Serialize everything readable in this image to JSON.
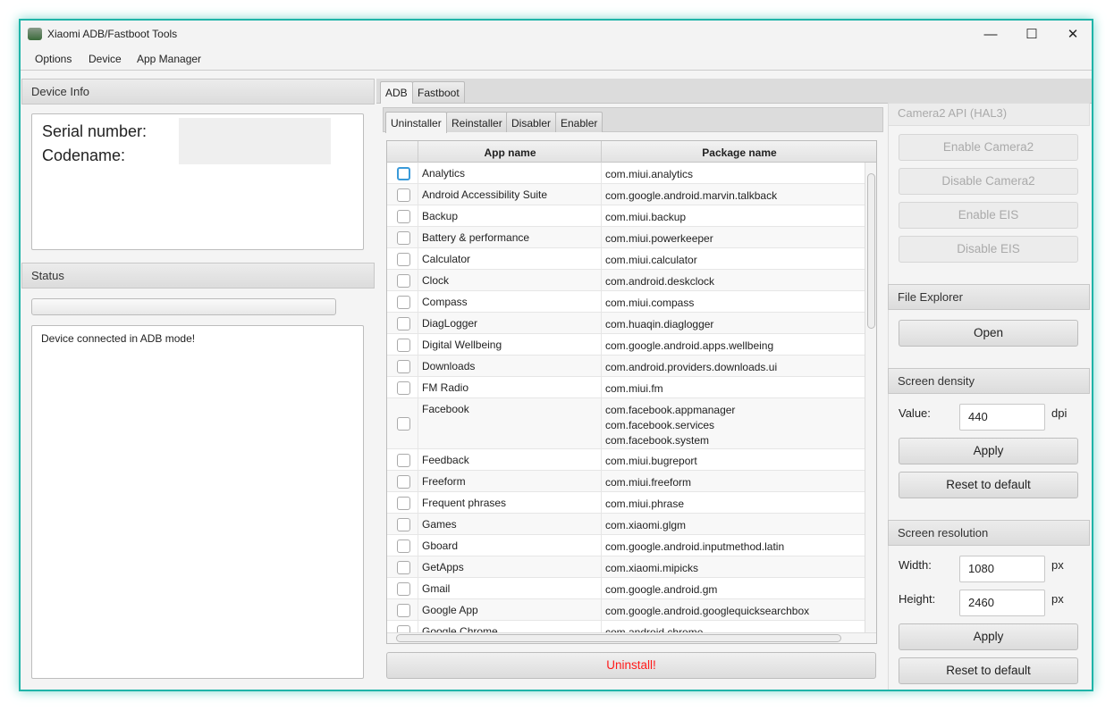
{
  "window": {
    "title": "Xiaomi ADB/Fastboot Tools",
    "minimize": "—",
    "maximize": "☐",
    "close": "✕"
  },
  "menu": [
    "Options",
    "Device",
    "App Manager"
  ],
  "device_info": {
    "header": "Device Info",
    "serial_label": "Serial number:",
    "codename_label": "Codename:"
  },
  "status": {
    "header": "Status",
    "progress": 0,
    "log": "Device connected in ADB mode!"
  },
  "tabs": [
    "ADB",
    "Fastboot"
  ],
  "subtabs": [
    "Uninstaller",
    "Reinstaller",
    "Disabler",
    "Enabler"
  ],
  "table": {
    "headers": [
      "App name",
      "Package name"
    ],
    "rows": [
      {
        "app": "Analytics",
        "pkg": [
          "com.miui.analytics"
        ]
      },
      {
        "app": "Android Accessibility Suite",
        "pkg": [
          "com.google.android.marvin.talkback"
        ]
      },
      {
        "app": "Backup",
        "pkg": [
          "com.miui.backup"
        ]
      },
      {
        "app": "Battery & performance",
        "pkg": [
          "com.miui.powerkeeper"
        ]
      },
      {
        "app": "Calculator",
        "pkg": [
          "com.miui.calculator"
        ]
      },
      {
        "app": "Clock",
        "pkg": [
          "com.android.deskclock"
        ]
      },
      {
        "app": "Compass",
        "pkg": [
          "com.miui.compass"
        ]
      },
      {
        "app": "DiagLogger",
        "pkg": [
          "com.huaqin.diaglogger"
        ]
      },
      {
        "app": "Digital Wellbeing",
        "pkg": [
          "com.google.android.apps.wellbeing"
        ]
      },
      {
        "app": "Downloads",
        "pkg": [
          "com.android.providers.downloads.ui"
        ]
      },
      {
        "app": "FM Radio",
        "pkg": [
          "com.miui.fm"
        ]
      },
      {
        "app": "Facebook",
        "pkg": [
          "com.facebook.appmanager",
          "com.facebook.services",
          "com.facebook.system"
        ]
      },
      {
        "app": "Feedback",
        "pkg": [
          "com.miui.bugreport"
        ]
      },
      {
        "app": "Freeform",
        "pkg": [
          "com.miui.freeform"
        ]
      },
      {
        "app": "Frequent phrases",
        "pkg": [
          "com.miui.phrase"
        ]
      },
      {
        "app": "Games",
        "pkg": [
          "com.xiaomi.glgm"
        ]
      },
      {
        "app": "Gboard",
        "pkg": [
          "com.google.android.inputmethod.latin"
        ]
      },
      {
        "app": "GetApps",
        "pkg": [
          "com.xiaomi.mipicks"
        ]
      },
      {
        "app": "Gmail",
        "pkg": [
          "com.google.android.gm"
        ]
      },
      {
        "app": "Google App",
        "pkg": [
          "com.google.android.googlequicksearchbox"
        ]
      },
      {
        "app": "Google Chrome",
        "pkg": [
          "com.android.chrome"
        ]
      }
    ]
  },
  "uninstall_button": "Uninstall!",
  "camera2": {
    "header": "Camera2 API (HAL3)",
    "buttons": [
      "Enable Camera2",
      "Disable Camera2",
      "Enable EIS",
      "Disable EIS"
    ]
  },
  "file_explorer": {
    "header": "File Explorer",
    "open": "Open"
  },
  "density": {
    "header": "Screen density",
    "label": "Value:",
    "value": "440",
    "unit": "dpi",
    "apply": "Apply",
    "reset": "Reset to default"
  },
  "resolution": {
    "header": "Screen resolution",
    "width_label": "Width:",
    "width": "1080",
    "height_label": "Height:",
    "height": "2460",
    "unit": "px",
    "apply": "Apply",
    "reset": "Reset to default"
  },
  "colors": {
    "accent": "#1fb4a8",
    "danger": "#ff1a1a"
  }
}
